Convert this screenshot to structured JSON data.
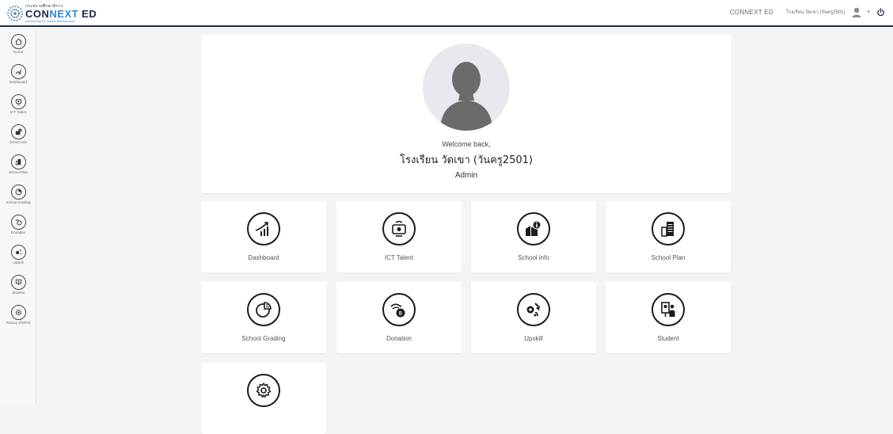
{
  "header": {
    "logo_small": "กระทรวงศึกษาธิการ",
    "logo_main_a": "CON",
    "logo_main_b": "NEXT",
    "logo_main_c": " ED",
    "logo_tag": "partnership for school development",
    "brand_link": "CONNEXT ED",
    "user_name": "โรงเรียน วัดเขา (วันครู2501)",
    "caret": "▾"
  },
  "sidebar": {
    "items": [
      {
        "label": "Home",
        "icon": "home-icon"
      },
      {
        "label": "Dashboard",
        "icon": "dashboard-icon"
      },
      {
        "label": "ICT Talent",
        "icon": "ict-talent-icon"
      },
      {
        "label": "School info",
        "icon": "school-info-icon"
      },
      {
        "label": "School Plan",
        "icon": "school-plan-icon"
      },
      {
        "label": "School Grading",
        "icon": "school-grading-icon"
      },
      {
        "label": "Donation",
        "icon": "donation-icon"
      },
      {
        "label": "Upskill",
        "icon": "upskill-icon"
      },
      {
        "label": "Student",
        "icon": "student-icon"
      },
      {
        "label": "Privacy (PDPA)",
        "icon": "privacy-icon"
      }
    ]
  },
  "profile": {
    "welcome": "Welcome back,",
    "school": "โรงเรียน วัดเขา (วันครู2501)",
    "role": "Admin"
  },
  "tiles": [
    {
      "label": "Dashboard",
      "icon": "dashboard-icon"
    },
    {
      "label": "ICT Talent",
      "icon": "ict-talent-icon"
    },
    {
      "label": "School info",
      "icon": "school-info-icon"
    },
    {
      "label": "School Plan",
      "icon": "school-plan-icon"
    },
    {
      "label": "School Grading",
      "icon": "school-grading-icon"
    },
    {
      "label": "Donation",
      "icon": "donation-icon"
    },
    {
      "label": "Upskill",
      "icon": "upskill-icon"
    },
    {
      "label": "Student",
      "icon": "student-icon"
    },
    {
      "label": "",
      "icon": "settings-icon"
    }
  ],
  "colors": {
    "brand_navy": "#1f2a44",
    "brand_blue": "#2c8ad6",
    "background": "#f3f4f6"
  }
}
